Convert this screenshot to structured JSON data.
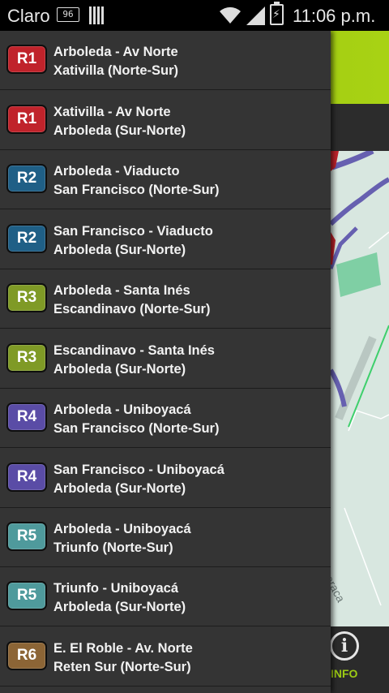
{
  "status_bar": {
    "carrier": "Claro",
    "badge_text": "96",
    "time": "11:06 p.m."
  },
  "map": {
    "street_label": "Soraca"
  },
  "bottom_bar": {
    "info_label": "INFO"
  },
  "routes": [
    {
      "code": "R1",
      "color": "#c0232b",
      "line1": "Arboleda - Av Norte",
      "line2": "Xativilla (Norte-Sur)"
    },
    {
      "code": "R1",
      "color": "#c0232b",
      "line1": "Xativilla - Av Norte",
      "line2": "Arboleda (Sur-Norte)"
    },
    {
      "code": "R2",
      "color": "#1f5f86",
      "line1": "Arboleda - Viaducto",
      "line2": "San Francisco (Norte-Sur)"
    },
    {
      "code": "R2",
      "color": "#1f5f86",
      "line1": "San Francisco - Viaducto",
      "line2": "Arboleda (Sur-Norte)"
    },
    {
      "code": "R3",
      "color": "#7f9a26",
      "line1": "Arboleda - Santa Inés",
      "line2": "Escandinavo (Norte-Sur)"
    },
    {
      "code": "R3",
      "color": "#7f9a26",
      "line1": "Escandinavo - Santa Inés",
      "line2": "Arboleda (Sur-Norte)"
    },
    {
      "code": "R4",
      "color": "#5a4ca6",
      "line1": "Arboleda - Uniboyacá",
      "line2": "San Francisco (Norte-Sur)"
    },
    {
      "code": "R4",
      "color": "#5a4ca6",
      "line1": "San Francisco - Uniboyacá",
      "line2": "Arboleda (Sur-Norte)"
    },
    {
      "code": "R5",
      "color": "#4f9a9c",
      "line1": "Arboleda - Uniboyacá",
      "line2": "Triunfo (Norte-Sur)"
    },
    {
      "code": "R5",
      "color": "#4f9a9c",
      "line1": "Triunfo - Uniboyacá",
      "line2": "Arboleda (Sur-Norte)"
    },
    {
      "code": "R6",
      "color": "#8c6536",
      "line1": "E. El Roble - Av. Norte",
      "line2": "Reten Sur (Norte-Sur)"
    }
  ]
}
